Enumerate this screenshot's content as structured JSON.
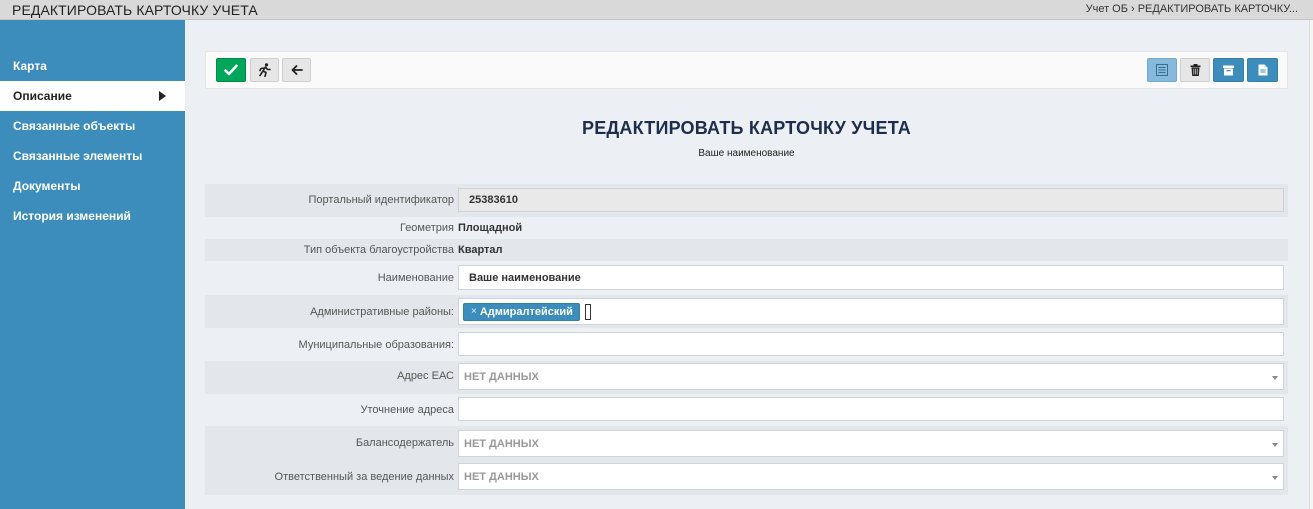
{
  "window": {
    "title": "РЕДАКТИРОВАТЬ КАРТОЧКУ УЧЕТА",
    "breadcrumb": "Учет ОБ › РЕДАКТИРОВАТЬ КАРТОЧКУ..."
  },
  "sidebar": {
    "items": [
      {
        "label": "Карта"
      },
      {
        "label": "Описание"
      },
      {
        "label": "Связанные объекты"
      },
      {
        "label": "Связанные элементы"
      },
      {
        "label": "Документы"
      },
      {
        "label": "История изменений"
      }
    ]
  },
  "toolbar": {
    "buttons": [
      {
        "icon": "check-icon",
        "color": "#00a65a"
      },
      {
        "icon": "run-icon",
        "color": "#e6e6e6"
      },
      {
        "icon": "arrow-left-icon",
        "color": "#e6e6e6"
      },
      {
        "icon": "list-icon",
        "color": "#86b9dc"
      },
      {
        "icon": "trash-icon",
        "color": "#e6e6e6"
      },
      {
        "icon": "archive-icon",
        "color": "#3c8dbc"
      },
      {
        "icon": "document-icon",
        "color": "#3c8dbc"
      }
    ]
  },
  "page": {
    "heading": "РЕДАКТИРОВАТЬ КАРТОЧКУ УЧЕТА",
    "subheading": "Ваше наименование"
  },
  "form": {
    "portal_id": {
      "label": "Портальный идентификатор",
      "value": "25383610"
    },
    "geometry": {
      "label": "Геометрия",
      "value": "Площадной"
    },
    "object_type": {
      "label": "Тип объекта благоустройства",
      "value": "Квартал"
    },
    "name": {
      "label": "Наименование",
      "value": "Ваше наименование"
    },
    "districts": {
      "label": "Административные районы:",
      "tags": [
        "Адмиралтейский"
      ],
      "remove_symbol": "×"
    },
    "municipal": {
      "label": "Муниципальные образования:",
      "value": ""
    },
    "address": {
      "label": "Адрес ЕАС",
      "value": "НЕТ ДАННЫХ"
    },
    "address_detail": {
      "label": "Уточнение адреса",
      "value": ""
    },
    "balance_holder": {
      "label": "Балансодержатель",
      "value": "НЕТ ДАННЫХ"
    },
    "responsible": {
      "label": "Ответственный за ведение данных",
      "value": "НЕТ ДАННЫХ"
    }
  },
  "colors": {
    "sidebar": "#3c8dbc",
    "accent_green": "#00a65a",
    "heading": "#1f2d4d"
  }
}
